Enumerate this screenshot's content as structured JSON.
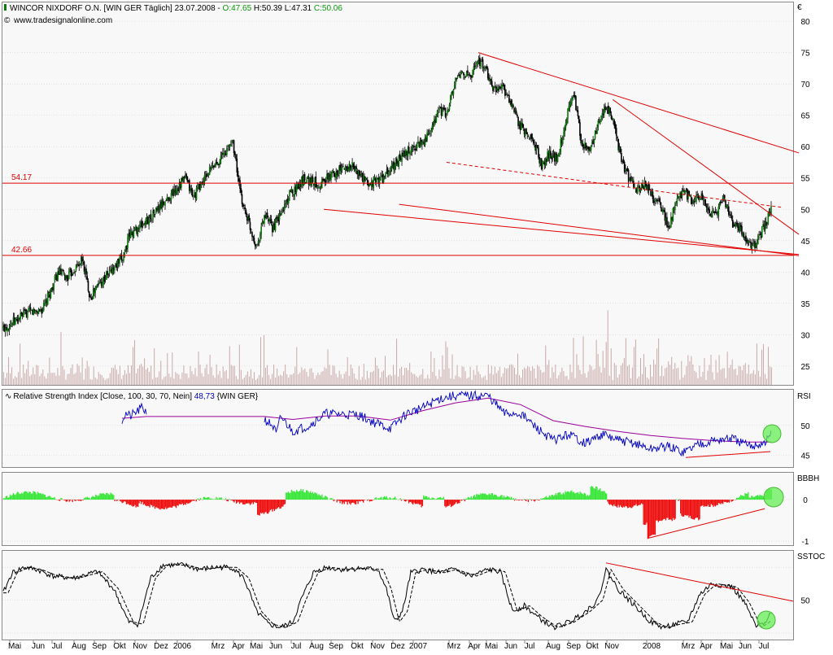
{
  "header": {
    "title_prefix": "WINCOR NIXDORF O.N. [WIN GER  Täglich] 23.07.2008 - ",
    "open": "O:47.65",
    "high": "H:50.39",
    "low": "L:47.31",
    "close": "C:50.06",
    "website": "www.tradesignalonline.com",
    "currency": "€"
  },
  "colors": {
    "candle": "#000000",
    "candle_up": "#0a7a0a",
    "line_red": "#e00000",
    "rsi": "#0000c0",
    "rsi_avg": "#9a009a",
    "bull": "#39e639",
    "bear": "#ee1111",
    "highlight": "#66ee55",
    "grid": "#d0d0d0",
    "volume": "#c9a9a9"
  },
  "chart_data": [
    {
      "type": "candlestick",
      "title": "WINCOR NIXDORF O.N. [WIN GER  Täglich]",
      "ylabel": "€",
      "ylim": [
        22,
        83
      ],
      "yticks": [
        25,
        30,
        35,
        40,
        45,
        50,
        55,
        60,
        65,
        70,
        75,
        80
      ],
      "grid": true,
      "x_labels": [
        "Mai",
        "Jun",
        "Jul",
        "Aug",
        "Sep",
        "Okt",
        "Nov",
        "Dez",
        "2006",
        "Mrz",
        "Apr",
        "Mai",
        "Jun",
        "Jul",
        "Aug",
        "Sep",
        "Okt",
        "Nov",
        "Dez",
        "2007",
        "Mrz",
        "Apr",
        "Mai",
        "Jun",
        "Jul",
        "Aug",
        "Sep",
        "Okt",
        "Nov",
        "2008",
        "Mrz",
        "Apr",
        "Mai",
        "Jun",
        "Jul"
      ],
      "last_bar": {
        "date": "23.07.2008",
        "open": 47.65,
        "high": 50.39,
        "low": 47.31,
        "close": 50.06
      },
      "close_path": [
        [
          0,
          31
        ],
        [
          3,
          33.5
        ],
        [
          5,
          34
        ],
        [
          7,
          40
        ],
        [
          8,
          39
        ],
        [
          10,
          42
        ],
        [
          11,
          36
        ],
        [
          12,
          38
        ],
        [
          15,
          42
        ],
        [
          16,
          46
        ],
        [
          18,
          48
        ],
        [
          21,
          52
        ],
        [
          23,
          55
        ],
        [
          24,
          52
        ],
        [
          26,
          56
        ],
        [
          28,
          59
        ],
        [
          29,
          61
        ],
        [
          30,
          52
        ],
        [
          31,
          48
        ],
        [
          32,
          44
        ],
        [
          33,
          49
        ],
        [
          34,
          47
        ],
        [
          35,
          49
        ],
        [
          36,
          52
        ],
        [
          38,
          55
        ],
        [
          40,
          54
        ],
        [
          42,
          56
        ],
        [
          44,
          57
        ],
        [
          46,
          54
        ],
        [
          48,
          55
        ],
        [
          50,
          58
        ],
        [
          52,
          60
        ],
        [
          54,
          62
        ],
        [
          55,
          66
        ],
        [
          56,
          65
        ],
        [
          57,
          70
        ],
        [
          58,
          72
        ],
        [
          59,
          71
        ],
        [
          60,
          74
        ],
        [
          61,
          72
        ],
        [
          62,
          69
        ],
        [
          63,
          70
        ],
        [
          64,
          67
        ],
        [
          65,
          64
        ],
        [
          66,
          62
        ],
        [
          67,
          61
        ],
        [
          68,
          57
        ],
        [
          69,
          59
        ],
        [
          70,
          58
        ],
        [
          71,
          64
        ],
        [
          72,
          69
        ],
        [
          73,
          61
        ],
        [
          74,
          59
        ],
        [
          75,
          63
        ],
        [
          76,
          66
        ],
        [
          77,
          65
        ],
        [
          78,
          58
        ],
        [
          79,
          55
        ],
        [
          80,
          53
        ],
        [
          81,
          54
        ],
        [
          82,
          52
        ],
        [
          83,
          51
        ],
        [
          84,
          47
        ],
        [
          85,
          51
        ],
        [
          86,
          53
        ],
        [
          87,
          51
        ],
        [
          88,
          52
        ],
        [
          89,
          50
        ],
        [
          90,
          49
        ],
        [
          91,
          52
        ],
        [
          92,
          48
        ],
        [
          93,
          47
        ],
        [
          94,
          45
        ],
        [
          95,
          44
        ],
        [
          96,
          47
        ],
        [
          97,
          50
        ]
      ],
      "horizontal_levels": [
        {
          "value": 54.17,
          "label": "54.17"
        },
        {
          "value": 42.66,
          "label": "42.66"
        }
      ],
      "volume_bars": true
    },
    {
      "type": "line",
      "title": "Relative Strength Index [Close, 100, 30, 70, Nein]",
      "title_value": "48,73",
      "title_instrument": "{WIN GER}",
      "axis_label": "RSI",
      "ylim": [
        43,
        56
      ],
      "yticks": [
        45,
        50
      ],
      "series": [
        {
          "name": "RSI",
          "points": [
            [
              150,
              51
            ],
            [
              155,
              52
            ],
            [
              160,
              51.5
            ],
            [
              175,
              53
            ],
            [
              180,
              52.2
            ],
            [
              325,
              51
            ],
            [
              335,
              50
            ],
            [
              340,
              48.5
            ],
            [
              345,
              51.5
            ],
            [
              360,
              49
            ],
            [
              380,
              50
            ],
            [
              400,
              52
            ],
            [
              440,
              51.8
            ],
            [
              460,
              50.5
            ],
            [
              480,
              49.5
            ],
            [
              500,
              52
            ],
            [
              520,
              53
            ],
            [
              540,
              54.5
            ],
            [
              560,
              55
            ],
            [
              600,
              55
            ],
            [
              620,
              52
            ],
            [
              640,
              52
            ],
            [
              660,
              49.5
            ],
            [
              680,
              47.5
            ],
            [
              700,
              48.5
            ],
            [
              720,
              47
            ],
            [
              740,
              48.5
            ],
            [
              760,
              47.5
            ],
            [
              780,
              47
            ],
            [
              800,
              46
            ],
            [
              820,
              46.5
            ],
            [
              840,
              45.5
            ],
            [
              860,
              47
            ],
            [
              880,
              47.5
            ],
            [
              900,
              47.8
            ],
            [
              920,
              46.5
            ],
            [
              940,
              47
            ],
            [
              948,
              48.7
            ]
          ]
        },
        {
          "name": "",
          "points": [
            [
              150,
              51.2
            ],
            [
              180,
              51.5
            ],
            [
              325,
              51.5
            ],
            [
              360,
              51
            ],
            [
              400,
              51.6
            ],
            [
              440,
              51.6
            ],
            [
              480,
              50.9
            ],
            [
              520,
              52.5
            ],
            [
              560,
              53.8
            ],
            [
              600,
              54.6
            ],
            [
              640,
              53.5
            ],
            [
              680,
              50.8
            ],
            [
              720,
              49.8
            ],
            [
              760,
              49
            ],
            [
              800,
              48.3
            ],
            [
              840,
              47.8
            ],
            [
              880,
              47.4
            ],
            [
              920,
              47.2
            ],
            [
              948,
              47.2
            ]
          ]
        }
      ]
    },
    {
      "type": "bar",
      "title": "",
      "axis_label": "BBBH",
      "ylim": [
        -1.1,
        0.65
      ],
      "yticks": [
        0,
        -1
      ],
      "baseline": 0
    },
    {
      "type": "line",
      "title": "",
      "axis_label": "SSTOC",
      "ylim": [
        14,
        95
      ],
      "yticks": [
        50
      ],
      "series": [
        {
          "name": "",
          "points": [
            [
              0,
              50
            ],
            [
              15,
              75
            ],
            [
              30,
              80
            ],
            [
              45,
              78
            ],
            [
              65,
              72
            ],
            [
              90,
              70
            ],
            [
              120,
              76
            ],
            [
              140,
              60
            ],
            [
              158,
              30
            ],
            [
              170,
              28
            ],
            [
              185,
              70
            ],
            [
              200,
              82
            ],
            [
              225,
              82
            ],
            [
              245,
              78
            ],
            [
              265,
              80
            ],
            [
              285,
              80
            ],
            [
              300,
              70
            ],
            [
              315,
              40
            ],
            [
              330,
              28
            ],
            [
              345,
              25
            ],
            [
              360,
              30
            ],
            [
              370,
              50
            ],
            [
              385,
              75
            ],
            [
              400,
              80
            ],
            [
              420,
              78
            ],
            [
              440,
              79
            ],
            [
              465,
              78
            ],
            [
              475,
              60
            ],
            [
              485,
              30
            ],
            [
              495,
              40
            ],
            [
              505,
              75
            ],
            [
              520,
              78
            ],
            [
              540,
              75
            ],
            [
              555,
              78
            ],
            [
              580,
              72
            ],
            [
              600,
              78
            ],
            [
              615,
              76
            ],
            [
              630,
              40
            ],
            [
              645,
              45
            ],
            [
              660,
              35
            ],
            [
              680,
              25
            ],
            [
              700,
              30
            ],
            [
              720,
              40
            ],
            [
              735,
              50
            ],
            [
              745,
              78
            ],
            [
              760,
              60
            ],
            [
              780,
              45
            ],
            [
              800,
              30
            ],
            [
              815,
              25
            ],
            [
              830,
              28
            ],
            [
              845,
              30
            ],
            [
              860,
              55
            ],
            [
              875,
              65
            ],
            [
              900,
              62
            ],
            [
              915,
              48
            ],
            [
              930,
              25
            ],
            [
              940,
              30
            ],
            [
              948,
              40
            ]
          ]
        }
      ]
    }
  ],
  "annotations": {
    "rsi_label": "RSI",
    "bbbh_label": "BBBH",
    "sstoc_label": "SSTOC"
  }
}
